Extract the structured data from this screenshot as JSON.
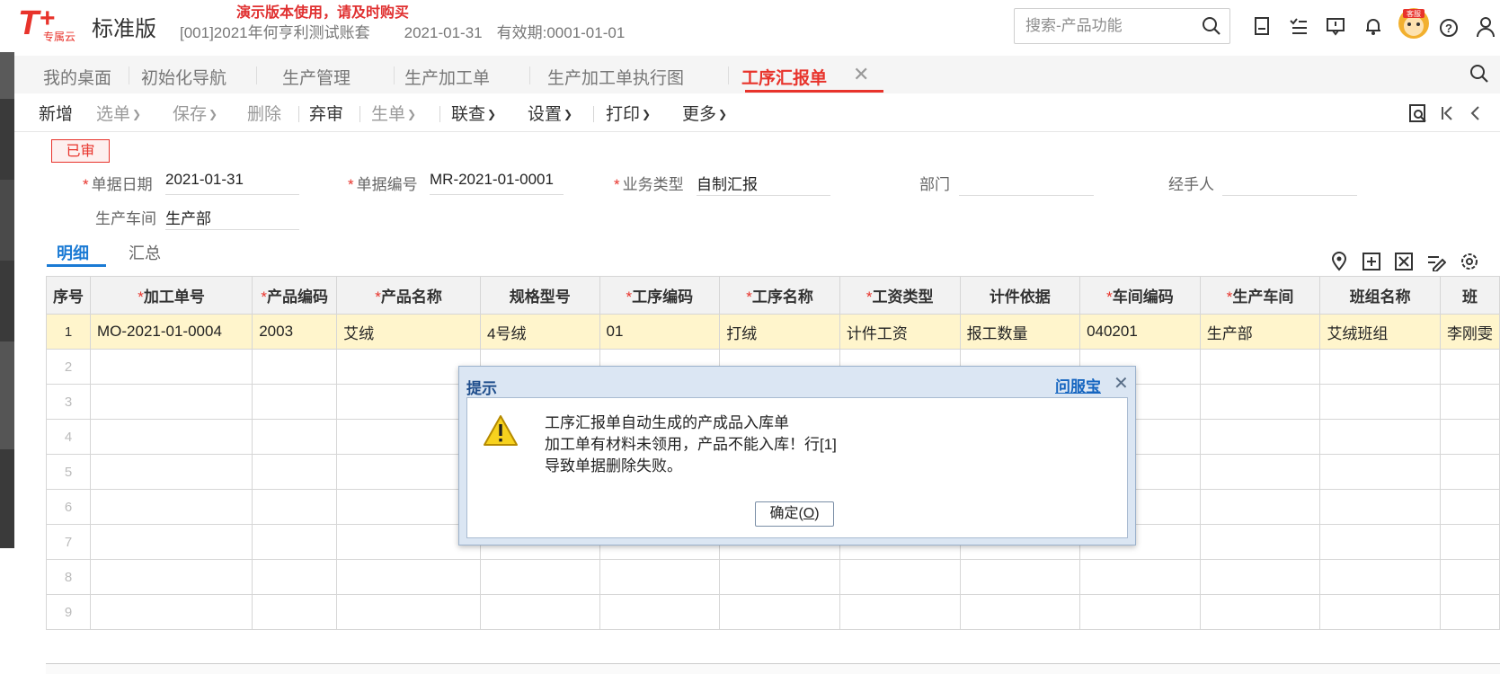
{
  "header": {
    "logo_text": "T+",
    "logo_sub": "专属云",
    "edition": "标准版",
    "demo_notice": "演示版本使用，请及时购买",
    "account": "[001]2021年何亨利测试账套",
    "date": "2021-01-31",
    "validity": "有效期:0001-01-01",
    "search_placeholder": "搜索-产品功能",
    "service_badge": "客服"
  },
  "tabs": [
    {
      "label": "我的桌面"
    },
    {
      "label": "初始化导航"
    },
    {
      "label": "生产管理"
    },
    {
      "label": "生产加工单"
    },
    {
      "label": "生产加工单执行图"
    },
    {
      "label": "工序汇报单",
      "active": true
    }
  ],
  "toolbar": {
    "new": "新增",
    "select": "选单",
    "save": "保存",
    "delete": "删除",
    "unaudit": "弃审",
    "generate": "生单",
    "linked_query": "联查",
    "settings": "设置",
    "print": "打印",
    "more": "更多"
  },
  "status_badge": "已审",
  "form": {
    "doc_date_label": "单据日期",
    "doc_date": "2021-01-31",
    "doc_no_label": "单据编号",
    "doc_no": "MR-2021-01-0001",
    "biz_type_label": "业务类型",
    "biz_type": "自制汇报",
    "dept_label": "部门",
    "dept": "",
    "handler_label": "经手人",
    "handler": "",
    "workshop_label": "生产车间",
    "workshop": "生产部"
  },
  "subtabs": {
    "detail": "明细",
    "summary": "汇总"
  },
  "grid": {
    "columns": [
      {
        "label": "序号",
        "required": false
      },
      {
        "label": "加工单号",
        "required": true
      },
      {
        "label": "产品编码",
        "required": true
      },
      {
        "label": "产品名称",
        "required": true
      },
      {
        "label": "规格型号",
        "required": false
      },
      {
        "label": "工序编码",
        "required": true
      },
      {
        "label": "工序名称",
        "required": true
      },
      {
        "label": "工资类型",
        "required": true
      },
      {
        "label": "计件依据",
        "required": false
      },
      {
        "label": "车间编码",
        "required": true
      },
      {
        "label": "生产车间",
        "required": true
      },
      {
        "label": "班组名称",
        "required": false
      },
      {
        "label": "班",
        "required": false
      }
    ],
    "rows": [
      [
        "1",
        "MO-2021-01-0004",
        "2003",
        "艾绒",
        "4号绒",
        "01",
        "打绒",
        "计件工资",
        "报工数量",
        "040201",
        "生产部",
        "艾绒班组",
        "李刚雯"
      ],
      [
        "2",
        "",
        "",
        "",
        "",
        "",
        "",
        "",
        "",
        "",
        "",
        "",
        ""
      ],
      [
        "3",
        "",
        "",
        "",
        "",
        "",
        "",
        "",
        "",
        "",
        "",
        "",
        ""
      ],
      [
        "4",
        "",
        "",
        "",
        "",
        "",
        "",
        "",
        "",
        "",
        "",
        "",
        ""
      ],
      [
        "5",
        "",
        "",
        "",
        "",
        "",
        "",
        "",
        "",
        "",
        "",
        "",
        ""
      ],
      [
        "6",
        "",
        "",
        "",
        "",
        "",
        "",
        "",
        "",
        "",
        "",
        "",
        ""
      ],
      [
        "7",
        "",
        "",
        "",
        "",
        "",
        "",
        "",
        "",
        "",
        "",
        "",
        ""
      ],
      [
        "8",
        "",
        "",
        "",
        "",
        "",
        "",
        "",
        "",
        "",
        "",
        "",
        ""
      ],
      [
        "9",
        "",
        "",
        "",
        "",
        "",
        "",
        "",
        "",
        "",
        "",
        "",
        ""
      ]
    ]
  },
  "dialog": {
    "title": "提示",
    "help_link": "问服宝",
    "message_lines": [
      "工序汇报单自动生成的产成品入库单",
      "加工单有材料未领用，产品不能入库！行[1]",
      "导致单据删除失败。"
    ],
    "ok_label": "确定(",
    "ok_key": "O",
    "ok_end": ")"
  },
  "colors": {
    "accent": "#e8332b",
    "link": "#1a7ad4",
    "selected_row": "#fff5cc"
  }
}
